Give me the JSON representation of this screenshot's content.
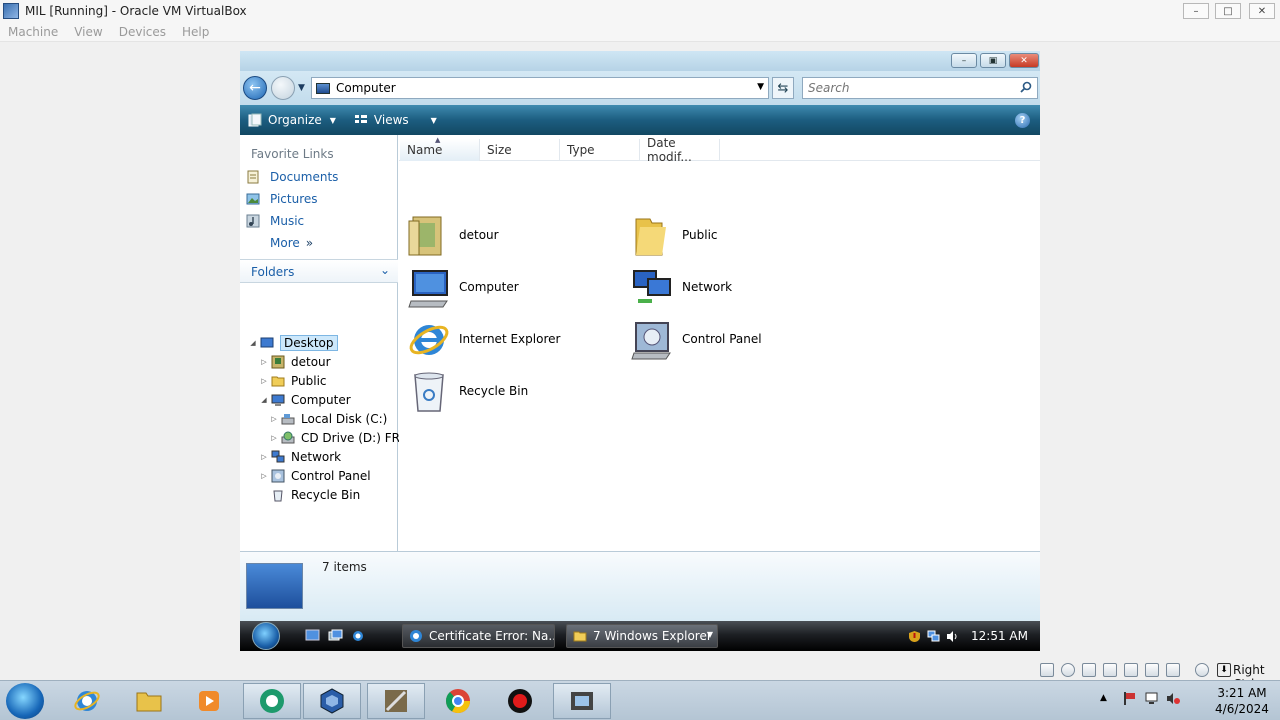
{
  "host": {
    "title": "MIL [Running] - Oracle VM VirtualBox",
    "menu": [
      "Machine",
      "View",
      "Devices",
      "Help"
    ],
    "host_key_label": "Right Ctrl",
    "clock_time": "3:21 AM",
    "clock_date": "4/6/2024"
  },
  "explorer": {
    "address": "Computer",
    "search_placeholder": "Search",
    "toolbar": {
      "organize": "Organize",
      "views": "Views"
    },
    "favorite_links_header": "Favorite Links",
    "favorites": [
      "Documents",
      "Pictures",
      "Music",
      "More"
    ],
    "more_chevron": "»",
    "folders_header": "Folders",
    "tree": [
      {
        "label": "Desktop",
        "level": 0
      },
      {
        "label": "detour",
        "level": 1
      },
      {
        "label": "Public",
        "level": 1
      },
      {
        "label": "Computer",
        "level": 1
      },
      {
        "label": "Local Disk (C:)",
        "level": 2
      },
      {
        "label": "CD Drive (D:) FRTI",
        "level": 2
      },
      {
        "label": "Network",
        "level": 1
      },
      {
        "label": "Control Panel",
        "level": 1
      },
      {
        "label": "Recycle Bin",
        "level": 1
      }
    ],
    "columns": [
      "Name",
      "Size",
      "Type",
      "Date modif..."
    ],
    "items": [
      "detour",
      "Public",
      "Computer",
      "Network",
      "Internet Explorer",
      "Control Panel",
      "Recycle Bin"
    ],
    "item_count": "7 items"
  },
  "guest_taskbar": {
    "tasks": [
      {
        "label": "Certificate Error: Na..."
      },
      {
        "label": "7 Windows Explorer"
      }
    ],
    "clock": "12:51 AM"
  },
  "colors": {
    "toolbar": "#1c5d80",
    "link": "#1b5fa8",
    "selection": "#cde8fb"
  },
  "icons": [
    "back-arrow-icon",
    "forward-arrow-icon",
    "refresh-icon",
    "search-icon",
    "help-icon",
    "folder-icon",
    "computer-icon",
    "network-icon",
    "internet-explorer-icon",
    "control-panel-icon",
    "recycle-bin-icon"
  ]
}
